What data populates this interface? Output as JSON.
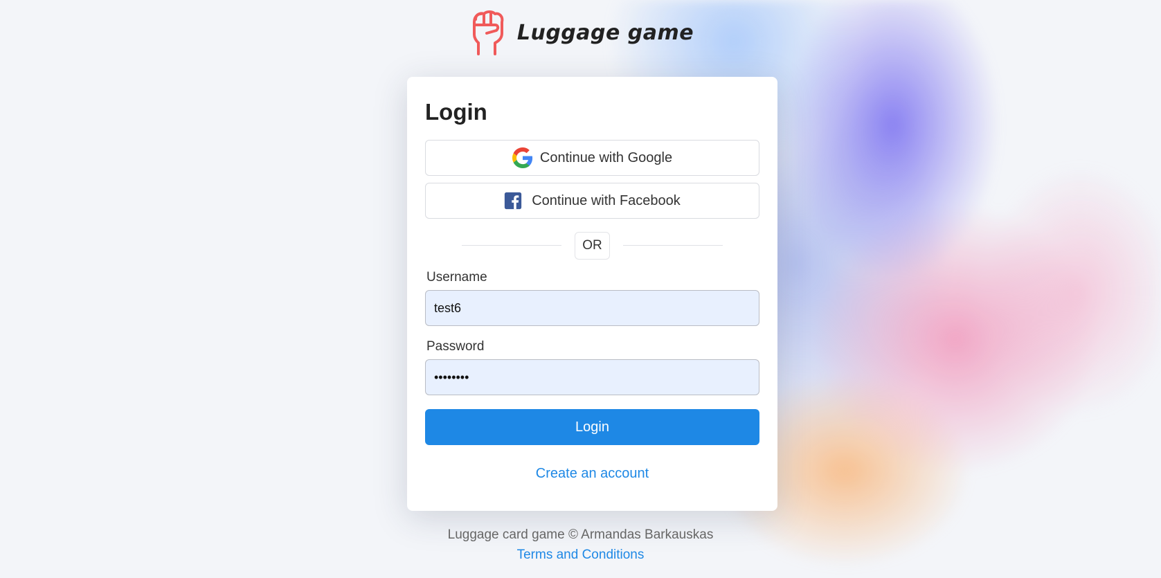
{
  "header": {
    "title": "Luggage game",
    "logo_icon": "raised-fist-icon"
  },
  "login": {
    "title": "Login",
    "google_label": "Continue with Google",
    "facebook_label": "Continue with Facebook",
    "divider_label": "OR",
    "username_label": "Username",
    "username_value": "test6",
    "password_label": "Password",
    "password_value": "••••••••",
    "submit_label": "Login",
    "create_account_label": "Create an account"
  },
  "footer": {
    "copyright": "Luggage card game © Armandas Barkauskas",
    "terms_label": "Terms and Conditions"
  },
  "colors": {
    "accent": "#1e88e5",
    "input_bg": "#e8f0fe",
    "logo": "#f05a5a",
    "facebook": "#3b5998"
  }
}
